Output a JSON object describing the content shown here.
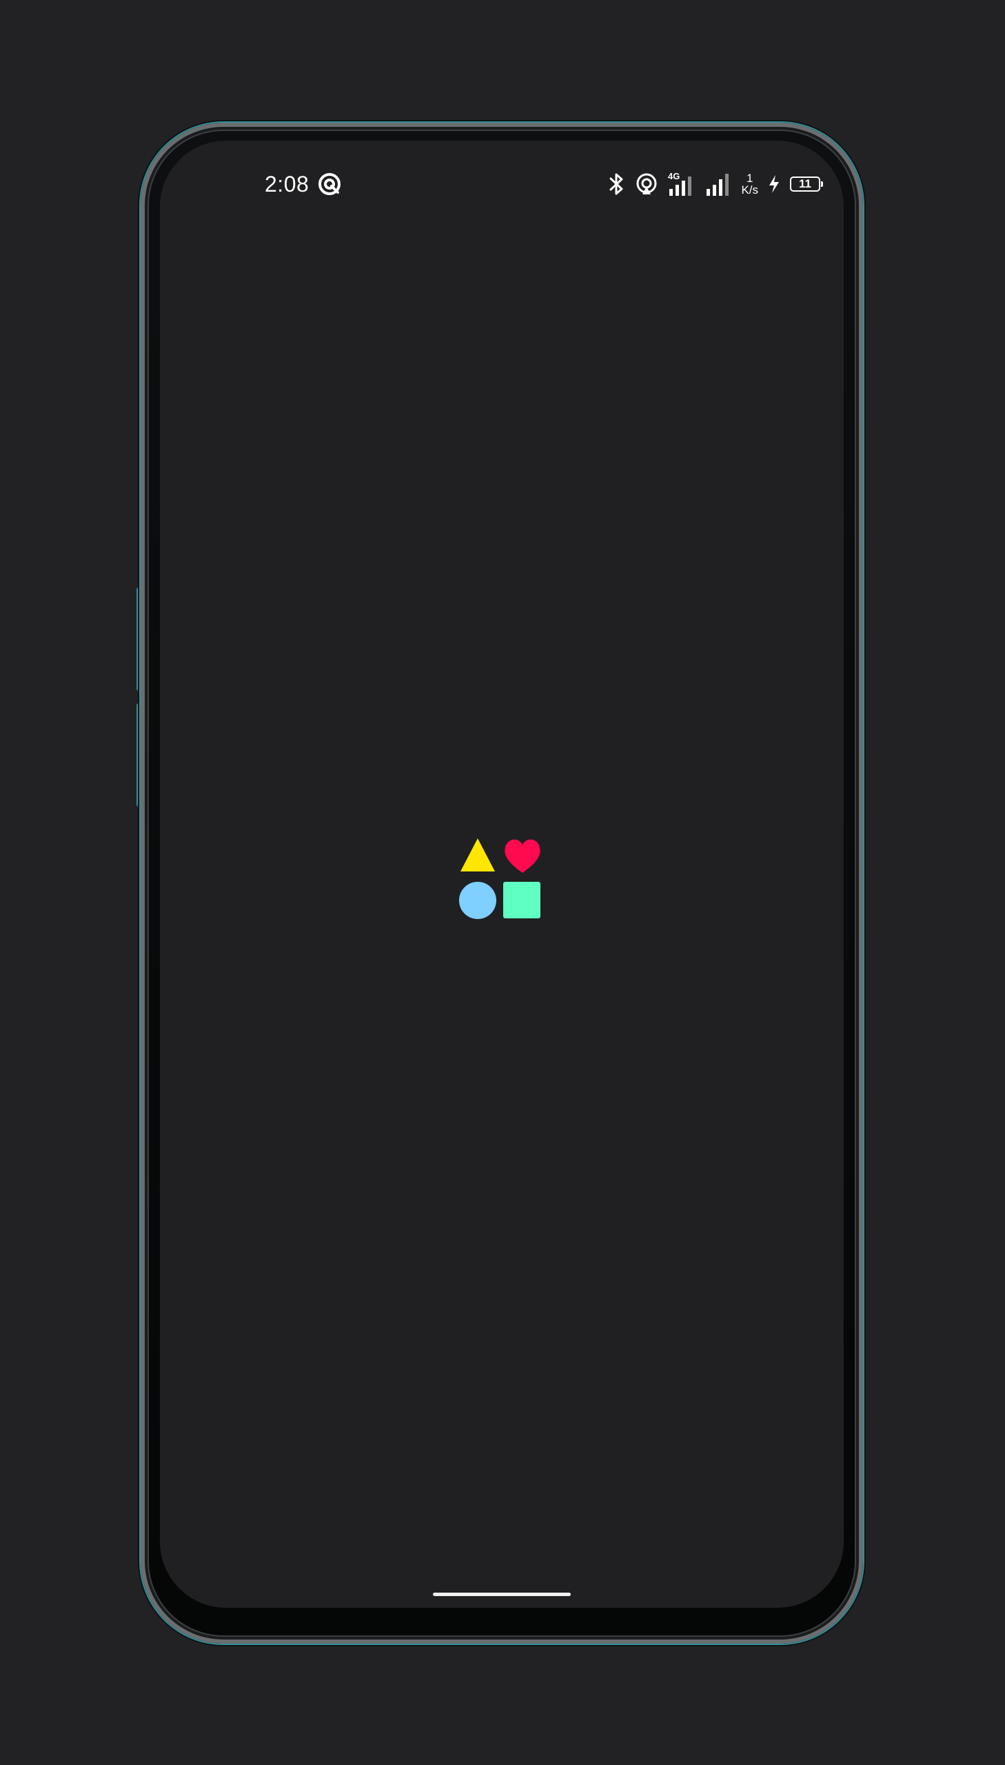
{
  "status_bar": {
    "time": "2:08",
    "network_type": "4G",
    "net_speed_value": "1",
    "net_speed_unit": "K/s",
    "battery_level": "11",
    "icons": {
      "left": [
        "app-notification-icon"
      ],
      "right": [
        "bluetooth-icon",
        "hotspot-icon",
        "signal-4g-icon",
        "signal-icon",
        "charging-icon",
        "battery-icon"
      ]
    }
  },
  "app_logo": {
    "icon": "app-logo-shapes",
    "shapes": [
      "triangle",
      "heart",
      "circle",
      "square"
    ],
    "colors": {
      "triangle": "#FFE600",
      "heart": "#FF0A4E",
      "circle": "#7FD0FF",
      "square": "#5FFFC4"
    }
  },
  "colors": {
    "screen_background": "#202022",
    "page_background": "#222224",
    "frame_accent": "#2F8F98"
  }
}
